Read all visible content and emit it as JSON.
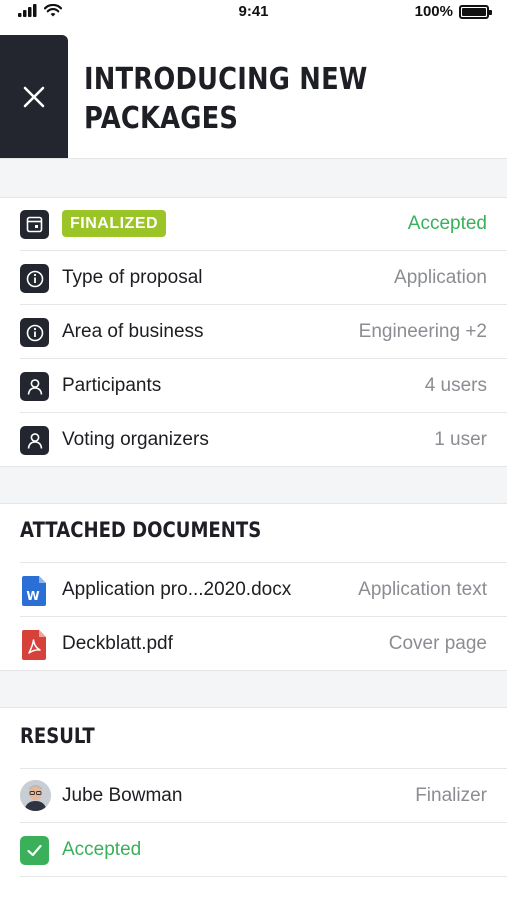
{
  "status_bar": {
    "time": "9:41",
    "battery": "100%"
  },
  "header": {
    "title_line1": "INTRODUCING NEW",
    "title_line2": "PACKAGES"
  },
  "details": {
    "status_badge": "FINALIZED",
    "status_value": "Accepted",
    "rows": [
      {
        "label": "Type of proposal",
        "value": "Application",
        "icon": "info-icon"
      },
      {
        "label": "Area of business",
        "value": "Engineering +2",
        "icon": "info-icon"
      },
      {
        "label": "Participants",
        "value": "4 users",
        "icon": "person-icon"
      },
      {
        "label": "Voting organizers",
        "value": "1 user",
        "icon": "person-icon"
      }
    ]
  },
  "documents": {
    "title": "ATTACHED DOCUMENTS",
    "items": [
      {
        "name": "Application pro...2020.docx",
        "type": "Application text",
        "icon": "word-doc-icon"
      },
      {
        "name": "Deckblatt.pdf",
        "type": "Cover page",
        "icon": "pdf-doc-icon"
      }
    ]
  },
  "result": {
    "title": "RESULT",
    "person_name": "Jube Bowman",
    "person_role": "Finalizer",
    "outcome": "Accepted"
  },
  "colors": {
    "dark": "#23262f",
    "accent_green": "#3ab05a",
    "badge_green": "#9bc527",
    "word_blue": "#2b6fd6",
    "pdf_red": "#d6423a"
  }
}
